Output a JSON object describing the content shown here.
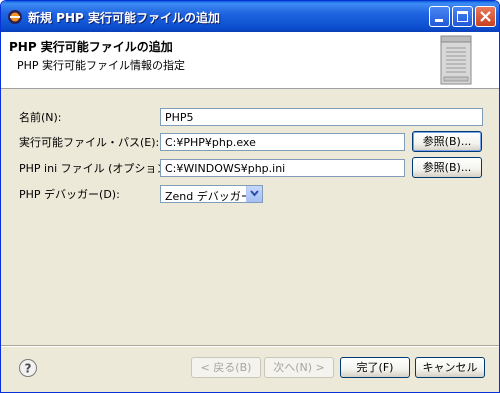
{
  "window": {
    "title": "新規 PHP 実行可能ファイルの追加"
  },
  "banner": {
    "title": "PHP 実行可能ファイルの追加",
    "subtitle": "PHP 実行可能ファイル情報の指定"
  },
  "form": {
    "name_label": "名前(N):",
    "name_value": "PHP5",
    "exe_label": "実行可能ファイル・パス(E):",
    "exe_value": "C:¥PHP¥php.exe",
    "exe_browse_label": "参照(B)...",
    "ini_label": "PHP ini ファイル (オプション)(I):",
    "ini_value": "C:¥WINDOWS¥php.ini",
    "ini_browse_label": "参照(B)...",
    "debugger_label": "PHP デバッガー(D):",
    "debugger_value": "Zend デバッガー"
  },
  "footer": {
    "help_icon": "help-icon",
    "back_label": "< 戻る(B)",
    "next_label": "次へ(N) >",
    "finish_label": "完了(F)",
    "cancel_label": "キャンセル"
  }
}
